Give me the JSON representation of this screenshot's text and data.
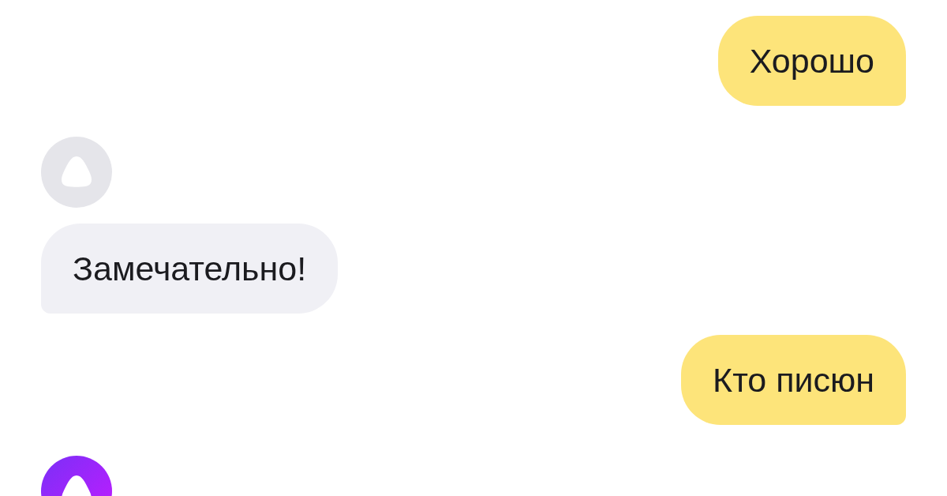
{
  "messages": [
    {
      "kind": "user",
      "text": "Хорошо"
    },
    {
      "kind": "avatar",
      "active": false
    },
    {
      "kind": "assistant",
      "text": "Замечательно!"
    },
    {
      "kind": "user",
      "text": "Кто писюн"
    },
    {
      "kind": "avatar",
      "active": true
    }
  ]
}
